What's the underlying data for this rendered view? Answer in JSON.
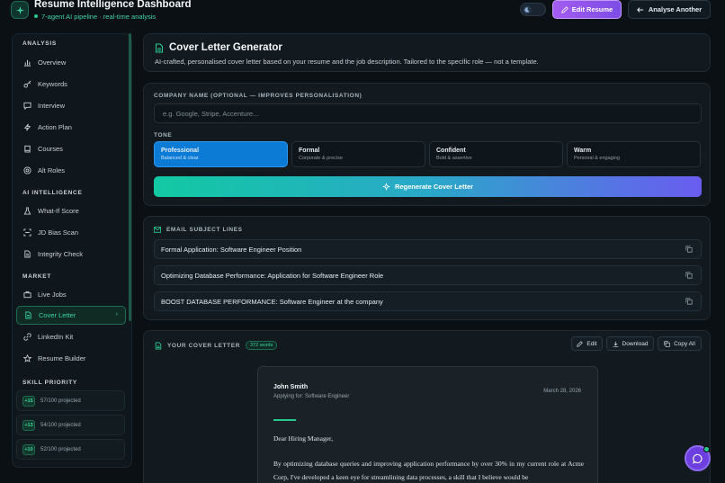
{
  "header": {
    "title": "Resume Intelligence Dashboard",
    "subtitle": "7-agent AI pipeline · real-time analysis",
    "edit_resume": "Edit Resume",
    "analyse_another": "Analyse Another"
  },
  "sidebar": {
    "sections": [
      {
        "label": "ANALYSIS",
        "items": [
          {
            "label": "Overview",
            "icon": "chart-icon"
          },
          {
            "label": "Keywords",
            "icon": "key-icon"
          },
          {
            "label": "Interview",
            "icon": "chat-icon"
          },
          {
            "label": "Action Plan",
            "icon": "bolt-icon"
          },
          {
            "label": "Courses",
            "icon": "book-icon"
          },
          {
            "label": "Alt Roles",
            "icon": "target-icon"
          }
        ]
      },
      {
        "label": "AI INTELLIGENCE",
        "items": [
          {
            "label": "What-If Score",
            "icon": "flask-icon"
          },
          {
            "label": "JD Bias Scan",
            "icon": "scan-icon"
          },
          {
            "label": "Integrity Check",
            "icon": "document-icon"
          }
        ]
      },
      {
        "label": "MARKET",
        "items": [
          {
            "label": "Live Jobs",
            "icon": "briefcase-icon"
          },
          {
            "label": "Cover Letter",
            "icon": "file-icon"
          },
          {
            "label": "LinkedIn Kit",
            "icon": "link-icon"
          },
          {
            "label": "Resume Builder",
            "icon": "star-icon"
          }
        ]
      }
    ],
    "skill_priority_label": "SKILL PRIORITY",
    "skills": [
      {
        "delta": "+15",
        "text": "57/100 projected"
      },
      {
        "delta": "+13",
        "text": "54/100 projected"
      },
      {
        "delta": "+10",
        "text": "52/100 projected"
      }
    ],
    "active_item": "Cover Letter"
  },
  "generator": {
    "title": "Cover Letter Generator",
    "description": "AI-crafted, personalised cover letter based on your resume and the job description. Tailored to the specific role — not a template.",
    "company_label": "COMPANY NAME (OPTIONAL — IMPROVES PERSONALISATION)",
    "company_placeholder": "e.g. Google, Stripe, Accenture...",
    "company_value": "",
    "tone_label": "TONE",
    "tones": [
      {
        "name": "Professional",
        "desc": "Balanced & clear"
      },
      {
        "name": "Formal",
        "desc": "Corporate & precise"
      },
      {
        "name": "Confident",
        "desc": "Bold & assertive"
      },
      {
        "name": "Warm",
        "desc": "Personal & engaging"
      }
    ],
    "selected_tone": "Professional",
    "regenerate": "Regenerate Cover Letter"
  },
  "subjects": {
    "label": "EMAIL SUBJECT LINES",
    "lines": [
      "Formal Application: Software Engineer Position",
      "Optimizing Database Performance: Application for Software Engineer Role",
      "BOOST DATABASE PERFORMANCE: Software Engineer at the company"
    ]
  },
  "cover_letter": {
    "label": "YOUR COVER LETTER",
    "word_count": "372 words",
    "edit": "Edit",
    "download": "Download",
    "copy_all": "Copy All",
    "name": "John Smith",
    "applying_for": "Applying for: Software Engineer",
    "date": "March 28, 2026",
    "greeting": "Dear Hiring Manager,",
    "body": "By optimizing database queries and improving application performance by over 30% in my current role at Acme Corp, I've developed a keen eye for streamlining data processes, a skill that I believe would be"
  },
  "colors": {
    "accent": "#26c98e",
    "tone_active": "#0b7bd6",
    "edit_button": "#a45cf0",
    "fab": "#6d3fe0"
  }
}
